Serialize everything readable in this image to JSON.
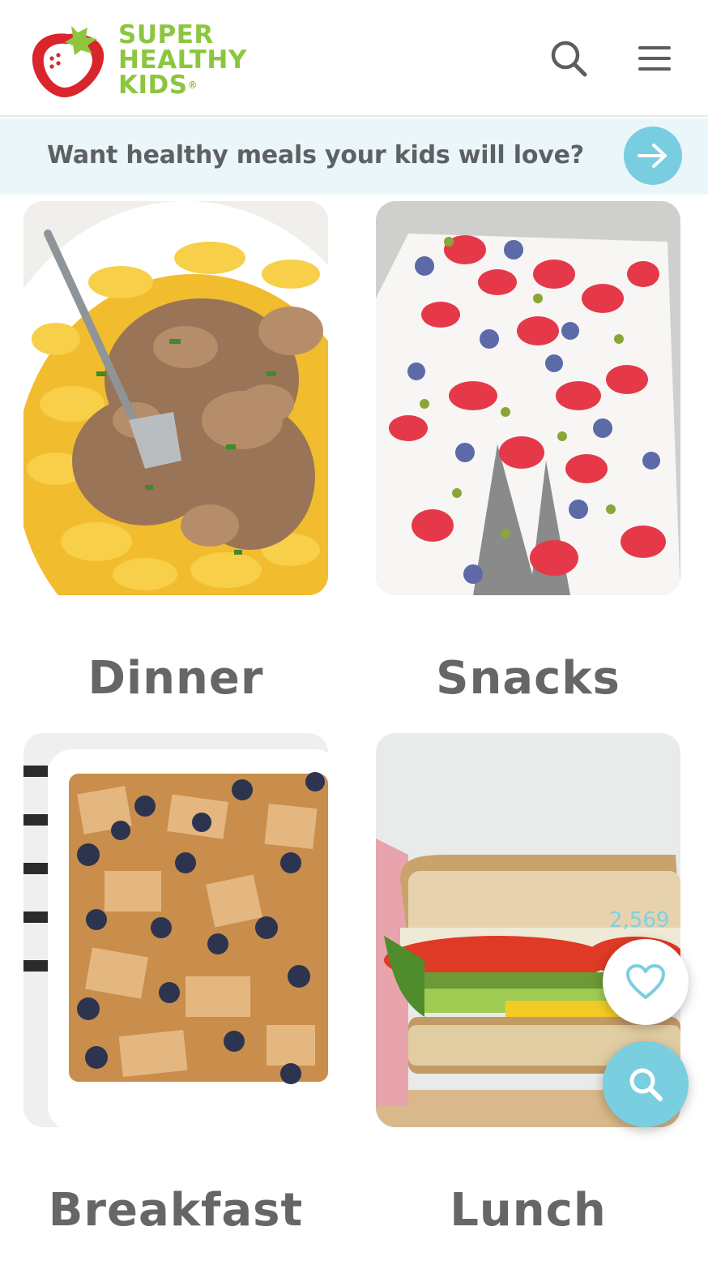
{
  "header": {
    "logo_lines": [
      "SUPER",
      "HEALTHY",
      "KIDS"
    ],
    "logo_reg": "®",
    "search_icon": "search-icon",
    "menu_icon": "hamburger-menu-icon"
  },
  "banner": {
    "text": "Want healthy meals your kids will love?",
    "arrow_icon": "arrow-right-icon"
  },
  "categories": [
    {
      "label": "Dinner",
      "image": "beef-stroganoff-noodles-photo"
    },
    {
      "label": "Snacks",
      "image": "yogurt-bark-berries-photo"
    },
    {
      "label": "Breakfast",
      "image": "blueberry-french-toast-bake-photo"
    },
    {
      "label": "Lunch",
      "image": "veggie-sandwich-photo"
    }
  ],
  "floating": {
    "save_count": "2,569",
    "heart_icon": "heart-icon",
    "search_icon": "search-icon"
  },
  "colors": {
    "brand_green": "#8cc63f",
    "brand_red": "#d9252b",
    "accent_teal": "#78cde0",
    "banner_bg": "#eaf6f9",
    "title_gray": "#666666"
  }
}
